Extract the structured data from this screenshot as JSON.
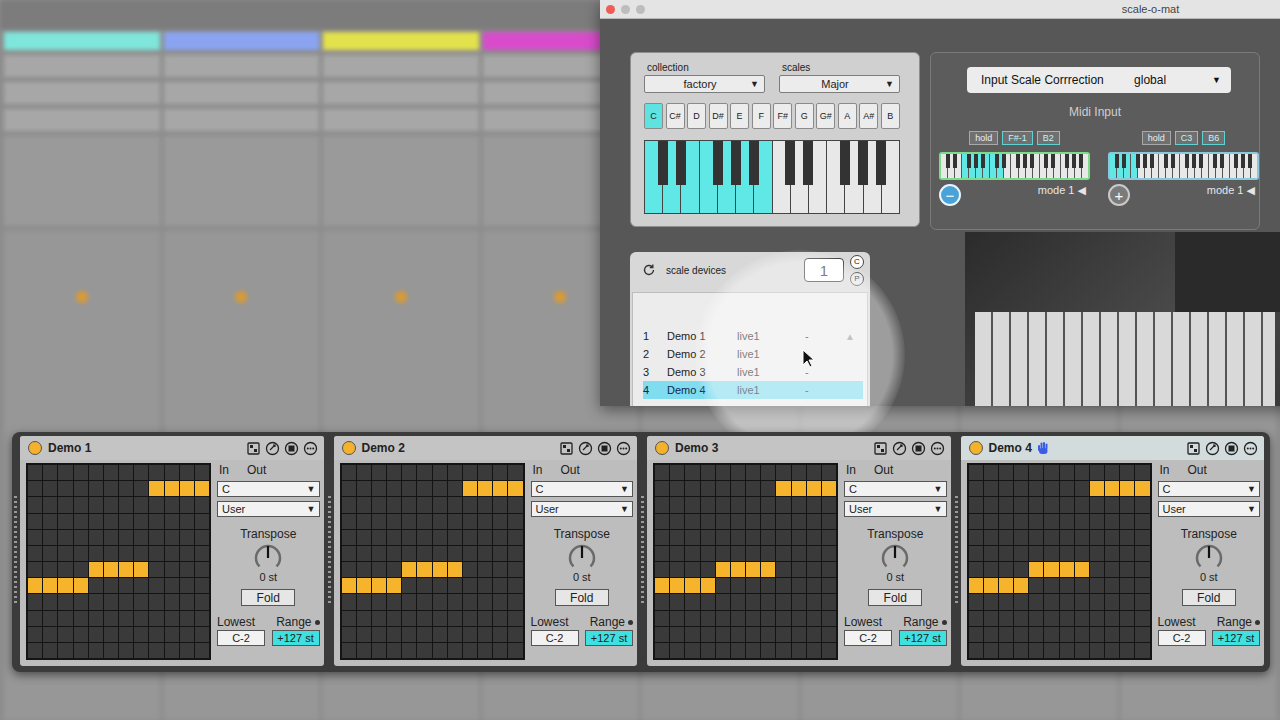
{
  "background": {
    "tracks": [
      {
        "color": "#7fe6dc"
      },
      {
        "color": "#8aa4f2"
      },
      {
        "color": "#e3e24c"
      },
      {
        "color": "#d84ccc"
      },
      {
        "color": "#d6e070"
      },
      {
        "color": "#e2df6c"
      },
      {
        "color": "#d4e25e"
      },
      {
        "color": "#4fe6a8"
      }
    ]
  },
  "window": {
    "title": "scale-o-mat"
  },
  "scale_panel": {
    "collection": {
      "label": "collection",
      "value": "factory",
      "arrow": "▼"
    },
    "scales": {
      "label": "scales",
      "value": "Major",
      "arrow": "▼"
    },
    "notes": [
      {
        "label": "C",
        "selected": true
      },
      {
        "label": "C#",
        "selected": false
      },
      {
        "label": "D",
        "selected": false
      },
      {
        "label": "D#",
        "selected": false
      },
      {
        "label": "E",
        "selected": false
      },
      {
        "label": "F",
        "selected": false
      },
      {
        "label": "F#",
        "selected": false
      },
      {
        "label": "G",
        "selected": false
      },
      {
        "label": "G#",
        "selected": false
      },
      {
        "label": "A",
        "selected": false
      },
      {
        "label": "A#",
        "selected": false
      },
      {
        "label": "B",
        "selected": false
      }
    ],
    "keyboard": {
      "white_keys": [
        {
          "on": true
        },
        {
          "on": true
        },
        {
          "on": true
        },
        {
          "on": true
        },
        {
          "on": true
        },
        {
          "on": true
        },
        {
          "on": true
        },
        {
          "on": false
        },
        {
          "on": false
        },
        {
          "on": false
        },
        {
          "on": false
        },
        {
          "on": false
        },
        {
          "on": false
        },
        {
          "on": false
        }
      ]
    }
  },
  "input_correction": {
    "label": "Input Scale Corrrection",
    "value": "global",
    "arrow": "▼"
  },
  "midi_input": {
    "label": "Midi Input",
    "zones": [
      {
        "hold": "hold",
        "low": "F#-1",
        "high": "B2",
        "mode": "mode 1",
        "mode_arrow": "◀",
        "selected": true,
        "button": "−",
        "button_selected": true,
        "keys": [
          {
            "on": false
          },
          {
            "on": false
          },
          {
            "on": false
          },
          {
            "on": true
          },
          {
            "on": true
          },
          {
            "on": true
          },
          {
            "on": true
          },
          {
            "on": true
          },
          {
            "on": true
          },
          {
            "on": false
          },
          {
            "on": false
          },
          {
            "on": false
          },
          {
            "on": false
          },
          {
            "on": false
          },
          {
            "on": false
          },
          {
            "on": false
          },
          {
            "on": false
          },
          {
            "on": false
          },
          {
            "on": false
          },
          {
            "on": false
          },
          {
            "on": false
          }
        ]
      },
      {
        "hold": "hold",
        "low": "C3",
        "high": "B6",
        "mode": "mode 1",
        "mode_arrow": "◀",
        "selected": false,
        "button": "+",
        "button_selected": false,
        "keys": [
          {
            "on": true
          },
          {
            "on": true
          },
          {
            "on": true
          },
          {
            "on": true
          },
          {
            "on": false
          },
          {
            "on": false
          },
          {
            "on": false
          },
          {
            "on": false
          },
          {
            "on": false
          },
          {
            "on": false
          },
          {
            "on": false
          },
          {
            "on": false
          },
          {
            "on": false
          },
          {
            "on": false
          },
          {
            "on": false
          },
          {
            "on": false
          },
          {
            "on": false
          },
          {
            "on": false
          },
          {
            "on": false
          },
          {
            "on": false
          },
          {
            "on": false
          }
        ]
      }
    ]
  },
  "scale_devices": {
    "title": "scale devices",
    "count": "1",
    "modes": [
      {
        "label": "C",
        "selected": true
      },
      {
        "label": "P",
        "selected": false
      }
    ],
    "scroll_arrow": "▲",
    "rows": [
      {
        "index": "1",
        "name": "Demo 1",
        "host": "live1",
        "status": "-",
        "selected": false
      },
      {
        "index": "2",
        "name": "Demo 2",
        "host": "live1",
        "status": "-",
        "selected": false
      },
      {
        "index": "3",
        "name": "Demo 3",
        "host": "live1",
        "status": "-",
        "selected": false
      },
      {
        "index": "4",
        "name": "Demo 4",
        "host": "live1",
        "status": "-",
        "selected": true
      }
    ]
  },
  "devices": [
    {
      "name": "Demo 1",
      "selected": false,
      "on": true,
      "hand": false,
      "in_label": "In",
      "out_label": "Out",
      "root": "C",
      "root_arrow": "▼",
      "scale": "User",
      "scale_arrow": "▼",
      "transpose_label": "Transpose",
      "transpose": "0 st",
      "transpose_level": 0.5,
      "fold": "Fold",
      "lowest_label": "Lowest",
      "range_label": "Range",
      "range_on": true,
      "lowest": "C-2",
      "range": "+127 st",
      "grid": [
        [
          false,
          false,
          false,
          false,
          false,
          false,
          false,
          false,
          false,
          false,
          false,
          false
        ],
        [
          false,
          false,
          false,
          false,
          false,
          false,
          false,
          false,
          true,
          true,
          true,
          true
        ],
        [
          false,
          false,
          false,
          false,
          false,
          false,
          false,
          false,
          false,
          false,
          false,
          false
        ],
        [
          false,
          false,
          false,
          false,
          false,
          false,
          false,
          false,
          false,
          false,
          false,
          false
        ],
        [
          false,
          false,
          false,
          false,
          false,
          false,
          false,
          false,
          false,
          false,
          false,
          false
        ],
        [
          false,
          false,
          false,
          false,
          false,
          false,
          false,
          false,
          false,
          false,
          false,
          false
        ],
        [
          false,
          false,
          false,
          false,
          true,
          true,
          true,
          true,
          false,
          false,
          false,
          false
        ],
        [
          true,
          true,
          true,
          true,
          false,
          false,
          false,
          false,
          false,
          false,
          false,
          false
        ],
        [
          false,
          false,
          false,
          false,
          false,
          false,
          false,
          false,
          false,
          false,
          false,
          false
        ],
        [
          false,
          false,
          false,
          false,
          false,
          false,
          false,
          false,
          false,
          false,
          false,
          false
        ],
        [
          false,
          false,
          false,
          false,
          false,
          false,
          false,
          false,
          false,
          false,
          false,
          false
        ],
        [
          false,
          false,
          false,
          false,
          false,
          false,
          false,
          false,
          false,
          false,
          false,
          false
        ]
      ]
    },
    {
      "name": "Demo 2",
      "selected": false,
      "on": true,
      "hand": false,
      "in_label": "In",
      "out_label": "Out",
      "root": "C",
      "root_arrow": "▼",
      "scale": "User",
      "scale_arrow": "▼",
      "transpose_label": "Transpose",
      "transpose": "0 st",
      "transpose_level": 0.5,
      "fold": "Fold",
      "lowest_label": "Lowest",
      "range_label": "Range",
      "range_on": true,
      "lowest": "C-2",
      "range": "+127 st",
      "grid": [
        [
          false,
          false,
          false,
          false,
          false,
          false,
          false,
          false,
          false,
          false,
          false,
          false
        ],
        [
          false,
          false,
          false,
          false,
          false,
          false,
          false,
          false,
          true,
          true,
          true,
          true
        ],
        [
          false,
          false,
          false,
          false,
          false,
          false,
          false,
          false,
          false,
          false,
          false,
          false
        ],
        [
          false,
          false,
          false,
          false,
          false,
          false,
          false,
          false,
          false,
          false,
          false,
          false
        ],
        [
          false,
          false,
          false,
          false,
          false,
          false,
          false,
          false,
          false,
          false,
          false,
          false
        ],
        [
          false,
          false,
          false,
          false,
          false,
          false,
          false,
          false,
          false,
          false,
          false,
          false
        ],
        [
          false,
          false,
          false,
          false,
          true,
          true,
          true,
          true,
          false,
          false,
          false,
          false
        ],
        [
          true,
          true,
          true,
          true,
          false,
          false,
          false,
          false,
          false,
          false,
          false,
          false
        ],
        [
          false,
          false,
          false,
          false,
          false,
          false,
          false,
          false,
          false,
          false,
          false,
          false
        ],
        [
          false,
          false,
          false,
          false,
          false,
          false,
          false,
          false,
          false,
          false,
          false,
          false
        ],
        [
          false,
          false,
          false,
          false,
          false,
          false,
          false,
          false,
          false,
          false,
          false,
          false
        ],
        [
          false,
          false,
          false,
          false,
          false,
          false,
          false,
          false,
          false,
          false,
          false,
          false
        ]
      ]
    },
    {
      "name": "Demo 3",
      "selected": false,
      "on": true,
      "hand": false,
      "in_label": "In",
      "out_label": "Out",
      "root": "C",
      "root_arrow": "▼",
      "scale": "User",
      "scale_arrow": "▼",
      "transpose_label": "Transpose",
      "transpose": "0 st",
      "transpose_level": 0.5,
      "fold": "Fold",
      "lowest_label": "Lowest",
      "range_label": "Range",
      "range_on": true,
      "lowest": "C-2",
      "range": "+127 st",
      "grid": [
        [
          false,
          false,
          false,
          false,
          false,
          false,
          false,
          false,
          false,
          false,
          false,
          false
        ],
        [
          false,
          false,
          false,
          false,
          false,
          false,
          false,
          false,
          true,
          true,
          true,
          true
        ],
        [
          false,
          false,
          false,
          false,
          false,
          false,
          false,
          false,
          false,
          false,
          false,
          false
        ],
        [
          false,
          false,
          false,
          false,
          false,
          false,
          false,
          false,
          false,
          false,
          false,
          false
        ],
        [
          false,
          false,
          false,
          false,
          false,
          false,
          false,
          false,
          false,
          false,
          false,
          false
        ],
        [
          false,
          false,
          false,
          false,
          false,
          false,
          false,
          false,
          false,
          false,
          false,
          false
        ],
        [
          false,
          false,
          false,
          false,
          true,
          true,
          true,
          true,
          false,
          false,
          false,
          false
        ],
        [
          true,
          true,
          true,
          true,
          false,
          false,
          false,
          false,
          false,
          false,
          false,
          false
        ],
        [
          false,
          false,
          false,
          false,
          false,
          false,
          false,
          false,
          false,
          false,
          false,
          false
        ],
        [
          false,
          false,
          false,
          false,
          false,
          false,
          false,
          false,
          false,
          false,
          false,
          false
        ],
        [
          false,
          false,
          false,
          false,
          false,
          false,
          false,
          false,
          false,
          false,
          false,
          false
        ],
        [
          false,
          false,
          false,
          false,
          false,
          false,
          false,
          false,
          false,
          false,
          false,
          false
        ]
      ]
    },
    {
      "name": "Demo 4",
      "selected": true,
      "on": true,
      "hand": true,
      "in_label": "In",
      "out_label": "Out",
      "root": "C",
      "root_arrow": "▼",
      "scale": "User",
      "scale_arrow": "▼",
      "transpose_label": "Transpose",
      "transpose": "0 st",
      "transpose_level": 0.5,
      "fold": "Fold",
      "lowest_label": "Lowest",
      "range_label": "Range",
      "range_on": true,
      "lowest": "C-2",
      "range": "+127 st",
      "grid": [
        [
          false,
          false,
          false,
          false,
          false,
          false,
          false,
          false,
          false,
          false,
          false,
          false
        ],
        [
          false,
          false,
          false,
          false,
          false,
          false,
          false,
          false,
          true,
          true,
          true,
          true
        ],
        [
          false,
          false,
          false,
          false,
          false,
          false,
          false,
          false,
          false,
          false,
          false,
          false
        ],
        [
          false,
          false,
          false,
          false,
          false,
          false,
          false,
          false,
          false,
          false,
          false,
          false
        ],
        [
          false,
          false,
          false,
          false,
          false,
          false,
          false,
          false,
          false,
          false,
          false,
          false
        ],
        [
          false,
          false,
          false,
          false,
          false,
          false,
          false,
          false,
          false,
          false,
          false,
          false
        ],
        [
          false,
          false,
          false,
          false,
          true,
          true,
          true,
          true,
          false,
          false,
          false,
          false
        ],
        [
          true,
          true,
          true,
          true,
          false,
          false,
          false,
          false,
          false,
          false,
          false,
          false
        ],
        [
          false,
          false,
          false,
          false,
          false,
          false,
          false,
          false,
          false,
          false,
          false,
          false
        ],
        [
          false,
          false,
          false,
          false,
          false,
          false,
          false,
          false,
          false,
          false,
          false,
          false
        ],
        [
          false,
          false,
          false,
          false,
          false,
          false,
          false,
          false,
          false,
          false,
          false,
          false
        ],
        [
          false,
          false,
          false,
          false,
          false,
          false,
          false,
          false,
          false,
          false,
          false,
          false
        ]
      ]
    }
  ]
}
